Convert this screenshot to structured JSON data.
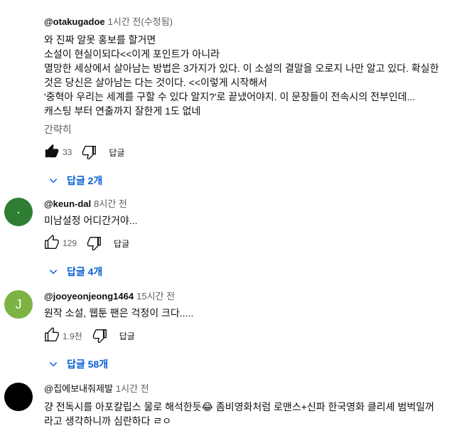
{
  "comments": [
    {
      "author": "@otakugadoe",
      "time": "1시간 전(수정됨)",
      "avatar_color": "#ffffff",
      "text": "와 진짜 알못 홍보를 할거면\n소설이 현실이되다<<이게 포인트가 아니라\n멸망한 세상에서 살아남는 방법은 3가지가 있다. 이 소설의 결말을 오로지 나만 알고 있다. 확실한\n것은 당신은 살아남는 다는 것이다. <<이렇게 시작해서\n'중혁아 우리는 세계를 구할 수 있다 알지?'로 끝냈어야지. 이 문장들이 전속시의 전부인데...\n캐스팅 부터 연출까지 잘한게 1도 없네",
      "more": "간략히",
      "likes": "33",
      "liked": true,
      "reply_label": "답글",
      "replies": "답글 2개"
    },
    {
      "author": "@keun-dal",
      "time": "8시간 전",
      "avatar_color": "#2e7d32",
      "avatar_text": "·",
      "text": "미남설정 어디간거야...",
      "likes": "129",
      "reply_label": "답글",
      "replies": "답글 4개"
    },
    {
      "author": "@jooyeonjeong1464",
      "time": "15시간 전",
      "avatar_color": "#7cb342",
      "avatar_text": "J",
      "text": "원작 소설, 웹툰 팬은 걱정이 크다.....",
      "likes": "1.9천",
      "reply_label": "답글",
      "replies": "답글 58개"
    },
    {
      "author": "@집에보내줘제발",
      "time": "1시간 전",
      "avatar_color": "#000000",
      "text": "걍 전독시를 아포칼립스 물로 해석한듯😂 좀비영화처럼 로맨스+신파 한국영화 클리셰 범벅일꺼\n라고 생각하니까 심란하다 ㄹㅇ"
    }
  ]
}
